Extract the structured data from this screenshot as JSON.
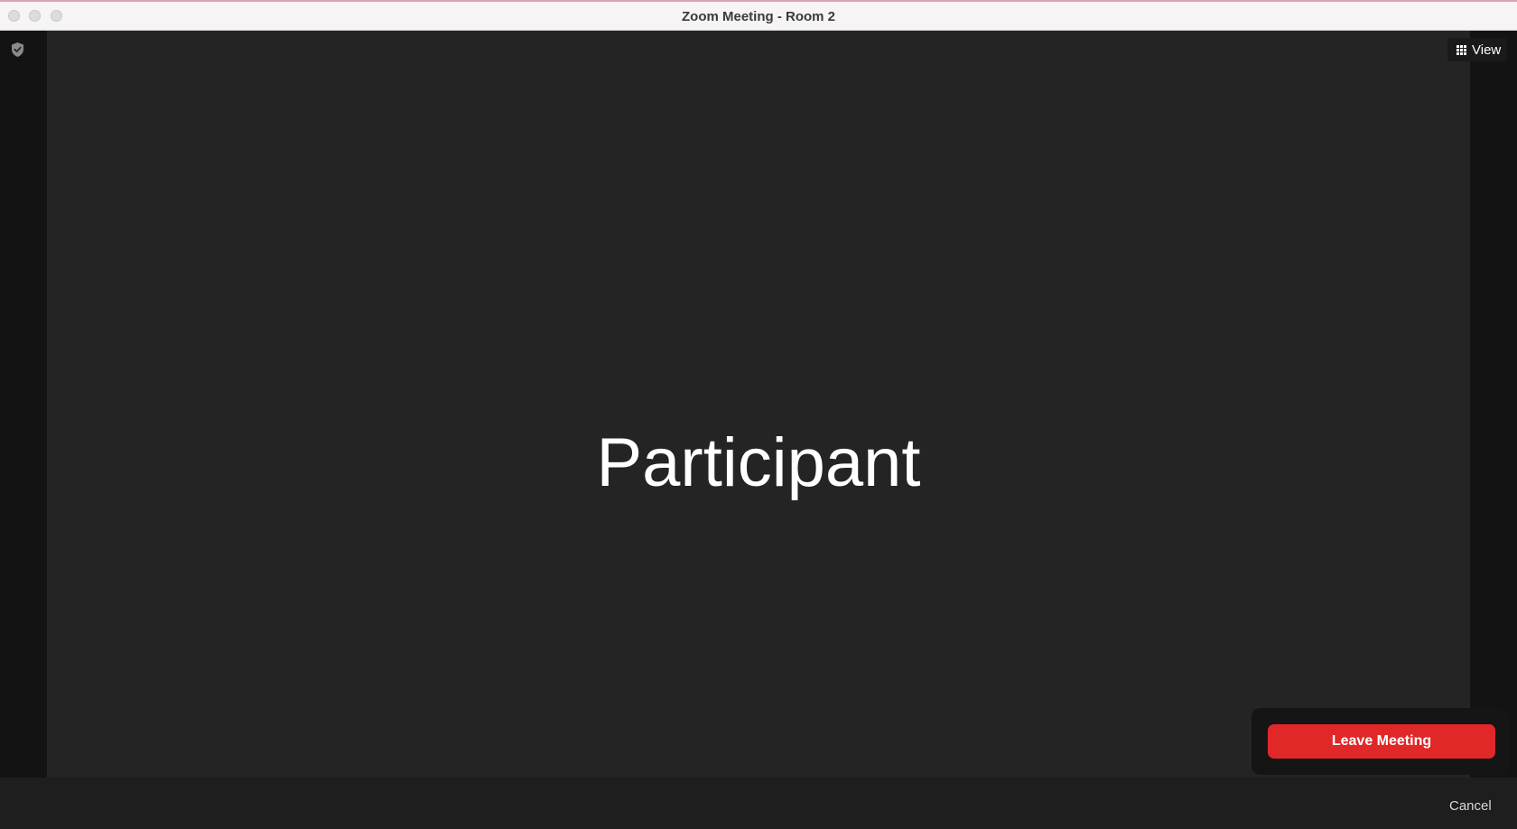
{
  "window": {
    "title": "Zoom Meeting - Room 2"
  },
  "toolbar": {
    "view_label": "View"
  },
  "video": {
    "participant_name": "Participant"
  },
  "leave_popup": {
    "leave_label": "Leave Meeting",
    "accent_color": "#e02828"
  },
  "bottom_bar": {
    "cancel_label": "Cancel"
  },
  "icons": {
    "security": "shield-check-icon",
    "view": "grid-icon"
  }
}
